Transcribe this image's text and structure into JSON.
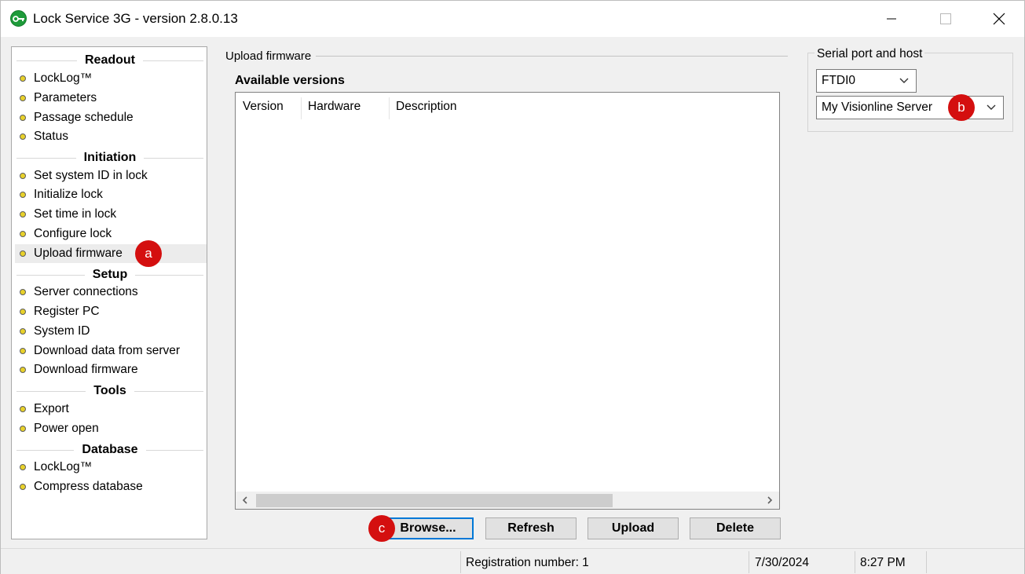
{
  "window": {
    "title": "Lock Service 3G - version 2.8.0.13"
  },
  "nav": {
    "sections": [
      {
        "header": "Readout",
        "items": [
          "LockLog™",
          "Parameters",
          "Passage schedule",
          "Status"
        ]
      },
      {
        "header": "Initiation",
        "items": [
          "Set system ID in lock",
          "Initialize lock",
          "Set time in lock",
          "Configure lock",
          "Upload firmware"
        ]
      },
      {
        "header": "Setup",
        "items": [
          "Server connections",
          "Register PC",
          "System ID",
          "Download data from server",
          "Download firmware"
        ]
      },
      {
        "header": "Tools",
        "items": [
          "Export",
          "Power open"
        ]
      },
      {
        "header": "Database",
        "items": [
          "LockLog™",
          "Compress database"
        ]
      }
    ],
    "selected": "Upload firmware"
  },
  "main": {
    "group_title": "Upload firmware",
    "available_title": "Available versions",
    "columns": [
      "Version",
      "Hardware",
      "Description"
    ],
    "rows": [],
    "buttons": {
      "browse": "Browse...",
      "refresh": "Refresh",
      "upload": "Upload",
      "delete": "Delete"
    }
  },
  "serial": {
    "group_title": "Serial port and host",
    "port_value": "FTDI0",
    "host_value": "My Visionline Server"
  },
  "markers": {
    "a": "a",
    "b": "b",
    "c": "c"
  },
  "statusbar": {
    "registration": "Registration number: 1",
    "date": "7/30/2024",
    "time": "8:27 PM"
  },
  "colors": {
    "accent": "#0078d7",
    "marker": "#d40f0f",
    "bullet": "#e8d12a",
    "app_icon": "#1e9b3a"
  }
}
